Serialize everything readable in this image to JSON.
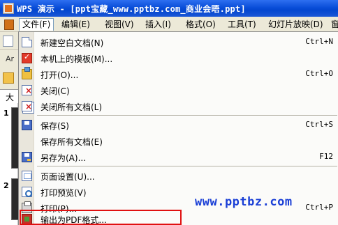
{
  "title": "WPS 演示 - [ppt宝藏_www.pptbz.com_商业会晤.ppt]",
  "menubar": {
    "items": [
      {
        "label": "文件(F)"
      },
      {
        "label": "编辑(E)"
      },
      {
        "label": "视图(V)"
      },
      {
        "label": "插入(I)"
      },
      {
        "label": "格式(O)"
      },
      {
        "label": "工具(T)"
      },
      {
        "label": "幻灯片放映(D)"
      },
      {
        "label": "窗"
      }
    ]
  },
  "left_panel": {
    "font_box_text": "Ar",
    "tab_text": "大纟",
    "slide_numbers": [
      "1",
      "2"
    ]
  },
  "file_menu": {
    "items": [
      {
        "label": "新建空白文档(N)",
        "shortcut": "Ctrl+N",
        "icon": "new-doc-icon"
      },
      {
        "label": "本机上的模板(M)...",
        "shortcut": "",
        "icon": "template-icon"
      },
      {
        "label": "打开(O)...",
        "shortcut": "Ctrl+O",
        "icon": "open-folder-icon"
      },
      {
        "label": "关闭(C)",
        "shortcut": "",
        "icon": "close-doc-icon"
      },
      {
        "label": "关闭所有文档(L)",
        "shortcut": "",
        "icon": "close-all-icon"
      },
      {
        "label": "保存(S)",
        "shortcut": "Ctrl+S",
        "icon": "save-icon"
      },
      {
        "label": "保存所有文档(E)",
        "shortcut": "",
        "icon": ""
      },
      {
        "label": "另存为(A)...",
        "shortcut": "F12",
        "icon": "save-as-icon"
      },
      {
        "label": "页面设置(U)...",
        "shortcut": "",
        "icon": "page-setup-icon"
      },
      {
        "label": "打印预览(V)",
        "shortcut": "",
        "icon": "print-preview-icon"
      },
      {
        "label": "打印(P)...",
        "shortcut": "Ctrl+P",
        "icon": "print-icon"
      },
      {
        "label": "输出为PDF格式...",
        "shortcut": "",
        "icon": "export-pdf-icon"
      }
    ]
  },
  "watermark": "www.pptbz.com",
  "colors": {
    "titlebar": "#0a4ed9",
    "highlight_border": "#e01010",
    "watermark": "#1a3fd6"
  }
}
